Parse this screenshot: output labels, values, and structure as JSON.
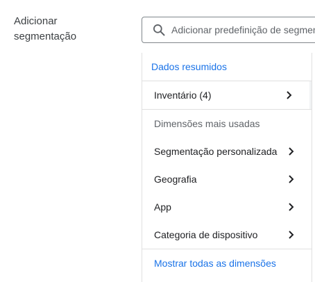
{
  "field": {
    "label_line1": "Adicionar",
    "label_line2": "segmentação"
  },
  "search": {
    "placeholder": "Adicionar predefinição de segmento"
  },
  "dropdown": {
    "summary_header": "Dados resumidos",
    "summary_items": [
      {
        "label": "Inventário (4)",
        "icon": "chevron-right-icon"
      }
    ],
    "common_header": "Dimensões mais usadas",
    "common_items": [
      {
        "label": "Segmentação personalizada",
        "icon": "chevron-right-icon"
      },
      {
        "label": "Geografia",
        "icon": "chevron-right-icon"
      },
      {
        "label": "App",
        "icon": "chevron-right-icon"
      },
      {
        "label": "Categoria de dispositivo",
        "icon": "chevron-right-icon"
      }
    ],
    "show_all_link": "Mostrar todas as dimensões"
  },
  "colors": {
    "accent": "#1a73e8",
    "text": "#202124",
    "muted": "#5f6368",
    "border": "#e0e0e0"
  }
}
